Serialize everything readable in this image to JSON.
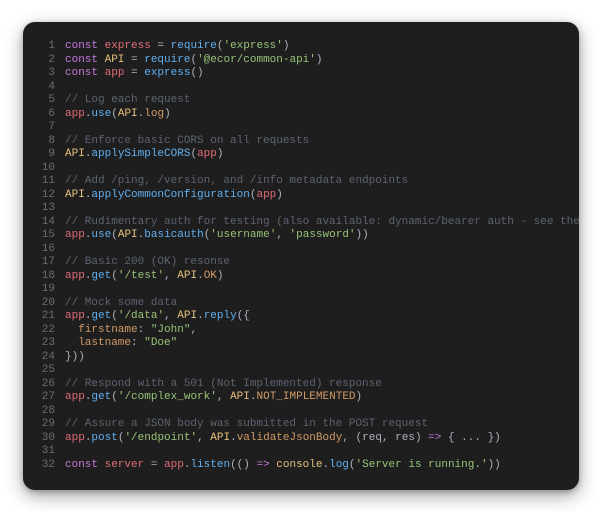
{
  "code": {
    "lines": [
      {
        "n": 1,
        "tokens": [
          [
            "kw",
            "const "
          ],
          [
            "var",
            "express"
          ],
          [
            "pun",
            " = "
          ],
          [
            "fn",
            "require"
          ],
          [
            "pun",
            "("
          ],
          [
            "str",
            "'express'"
          ],
          [
            "pun",
            ")"
          ]
        ]
      },
      {
        "n": 2,
        "tokens": [
          [
            "kw",
            "const "
          ],
          [
            "vblu",
            "API"
          ],
          [
            "pun",
            " = "
          ],
          [
            "fn",
            "require"
          ],
          [
            "pun",
            "("
          ],
          [
            "str",
            "'@ecor/common-api'"
          ],
          [
            "pun",
            ")"
          ]
        ]
      },
      {
        "n": 3,
        "tokens": [
          [
            "kw",
            "const "
          ],
          [
            "var",
            "app"
          ],
          [
            "pun",
            " = "
          ],
          [
            "fn",
            "express"
          ],
          [
            "pun",
            "()"
          ]
        ]
      },
      {
        "n": 4,
        "tokens": []
      },
      {
        "n": 5,
        "tokens": [
          [
            "cmt",
            "// Log each request"
          ]
        ]
      },
      {
        "n": 6,
        "tokens": [
          [
            "var",
            "app"
          ],
          [
            "pun",
            "."
          ],
          [
            "fn",
            "use"
          ],
          [
            "pun",
            "("
          ],
          [
            "vblu",
            "API"
          ],
          [
            "pun",
            "."
          ],
          [
            "prop",
            "log"
          ],
          [
            "pun",
            ")"
          ]
        ]
      },
      {
        "n": 7,
        "tokens": []
      },
      {
        "n": 8,
        "tokens": [
          [
            "cmt",
            "// Enforce basic CORS on all requests"
          ]
        ]
      },
      {
        "n": 9,
        "tokens": [
          [
            "vblu",
            "API"
          ],
          [
            "pun",
            "."
          ],
          [
            "fn",
            "applySimpleCORS"
          ],
          [
            "pun",
            "("
          ],
          [
            "var",
            "app"
          ],
          [
            "pun",
            ")"
          ]
        ]
      },
      {
        "n": 10,
        "tokens": []
      },
      {
        "n": 11,
        "tokens": [
          [
            "cmt",
            "// Add /ping, /version, and /info metadata endpoints"
          ]
        ]
      },
      {
        "n": 12,
        "tokens": [
          [
            "vblu",
            "API"
          ],
          [
            "pun",
            "."
          ],
          [
            "fn",
            "applyCommonConfiguration"
          ],
          [
            "pun",
            "("
          ],
          [
            "var",
            "app"
          ],
          [
            "pun",
            ")"
          ]
        ]
      },
      {
        "n": 13,
        "tokens": []
      },
      {
        "n": 14,
        "tokens": [
          [
            "cmt",
            "// Rudimentary auth for testing (also available: dynamic/bearer auth - see the docs)"
          ]
        ]
      },
      {
        "n": 15,
        "tokens": [
          [
            "var",
            "app"
          ],
          [
            "pun",
            "."
          ],
          [
            "fn",
            "use"
          ],
          [
            "pun",
            "("
          ],
          [
            "vblu",
            "API"
          ],
          [
            "pun",
            "."
          ],
          [
            "fn",
            "basicauth"
          ],
          [
            "pun",
            "("
          ],
          [
            "str",
            "'username'"
          ],
          [
            "pun",
            ", "
          ],
          [
            "str",
            "'password'"
          ],
          [
            "pun",
            "))"
          ]
        ]
      },
      {
        "n": 16,
        "tokens": []
      },
      {
        "n": 17,
        "tokens": [
          [
            "cmt",
            "// Basic 200 (OK) resonse"
          ]
        ]
      },
      {
        "n": 18,
        "tokens": [
          [
            "var",
            "app"
          ],
          [
            "pun",
            "."
          ],
          [
            "fn",
            "get"
          ],
          [
            "pun",
            "("
          ],
          [
            "str",
            "'/test'"
          ],
          [
            "pun",
            ", "
          ],
          [
            "vblu",
            "API"
          ],
          [
            "pun",
            "."
          ],
          [
            "prop",
            "OK"
          ],
          [
            "pun",
            ")"
          ]
        ]
      },
      {
        "n": 19,
        "tokens": []
      },
      {
        "n": 20,
        "tokens": [
          [
            "cmt",
            "// Mock some data"
          ]
        ]
      },
      {
        "n": 21,
        "tokens": [
          [
            "var",
            "app"
          ],
          [
            "pun",
            "."
          ],
          [
            "fn",
            "get"
          ],
          [
            "pun",
            "("
          ],
          [
            "str",
            "'/data'"
          ],
          [
            "pun",
            ", "
          ],
          [
            "vblu",
            "API"
          ],
          [
            "pun",
            "."
          ],
          [
            "fn",
            "reply"
          ],
          [
            "pun",
            "({"
          ]
        ]
      },
      {
        "n": 22,
        "tokens": [
          [
            "pun",
            "  "
          ],
          [
            "prop",
            "firstname"
          ],
          [
            "pun",
            ": "
          ],
          [
            "str",
            "\"John\""
          ],
          [
            "pun",
            ","
          ]
        ]
      },
      {
        "n": 23,
        "tokens": [
          [
            "pun",
            "  "
          ],
          [
            "prop",
            "lastname"
          ],
          [
            "pun",
            ": "
          ],
          [
            "str",
            "\"Doe\""
          ]
        ]
      },
      {
        "n": 24,
        "tokens": [
          [
            "pun",
            "}))"
          ]
        ]
      },
      {
        "n": 25,
        "tokens": []
      },
      {
        "n": 26,
        "tokens": [
          [
            "cmt",
            "// Respond with a 501 (Not Implemented) response"
          ]
        ]
      },
      {
        "n": 27,
        "tokens": [
          [
            "var",
            "app"
          ],
          [
            "pun",
            "."
          ],
          [
            "fn",
            "get"
          ],
          [
            "pun",
            "("
          ],
          [
            "str",
            "'/complex_work'"
          ],
          [
            "pun",
            ", "
          ],
          [
            "vblu",
            "API"
          ],
          [
            "pun",
            "."
          ],
          [
            "prop",
            "NOT_IMPLEMENTED"
          ],
          [
            "pun",
            ")"
          ]
        ]
      },
      {
        "n": 28,
        "tokens": []
      },
      {
        "n": 29,
        "tokens": [
          [
            "cmt",
            "// Assure a JSON body was submitted in the POST request"
          ]
        ]
      },
      {
        "n": 30,
        "tokens": [
          [
            "var",
            "app"
          ],
          [
            "pun",
            "."
          ],
          [
            "fn",
            "post"
          ],
          [
            "pun",
            "("
          ],
          [
            "str",
            "'/endpoint'"
          ],
          [
            "pun",
            ", "
          ],
          [
            "vblu",
            "API"
          ],
          [
            "pun",
            "."
          ],
          [
            "prop",
            "validateJsonBody"
          ],
          [
            "pun",
            ", ("
          ],
          [
            "arg",
            "req"
          ],
          [
            "pun",
            ", "
          ],
          [
            "arg",
            "res"
          ],
          [
            "pun",
            ") "
          ],
          [
            "kw",
            "=>"
          ],
          [
            "pun",
            " { ... })"
          ]
        ]
      },
      {
        "n": 31,
        "tokens": []
      },
      {
        "n": 32,
        "tokens": [
          [
            "kw",
            "const "
          ],
          [
            "var",
            "server"
          ],
          [
            "pun",
            " = "
          ],
          [
            "var",
            "app"
          ],
          [
            "pun",
            "."
          ],
          [
            "fn",
            "listen"
          ],
          [
            "pun",
            "(() "
          ],
          [
            "kw",
            "=>"
          ],
          [
            "pun",
            " "
          ],
          [
            "vblu",
            "console"
          ],
          [
            "pun",
            "."
          ],
          [
            "fn",
            "log"
          ],
          [
            "pun",
            "("
          ],
          [
            "str",
            "'Server is running.'"
          ],
          [
            "pun",
            "))"
          ]
        ]
      }
    ]
  }
}
